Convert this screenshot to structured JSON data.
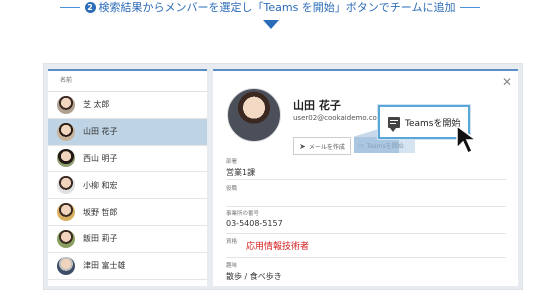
{
  "header": {
    "step_number": "2",
    "title": "検索結果からメンバーを選定し「Teams を開始」ボタンでチームに追加"
  },
  "list": {
    "column_header": "名前",
    "items": [
      {
        "name": "芝 太郎"
      },
      {
        "name": "山田 花子"
      },
      {
        "name": "西山 明子"
      },
      {
        "name": "小柳 和宏"
      },
      {
        "name": "坂野 哲郎"
      },
      {
        "name": "飯田 莉子"
      },
      {
        "name": "津田 富士雄"
      }
    ],
    "selected_index": 1
  },
  "detail": {
    "name": "山田 花子",
    "email": "user02@cookaidemo.co...",
    "mail_button": "メールを作成",
    "teams_button_ghost": "Teamsを開始",
    "teams_callout": "Teamsを開始",
    "fields": [
      {
        "label": "部署",
        "value": "営業1課"
      },
      {
        "label": "役職",
        "value": ""
      },
      {
        "label": "事業所の番号",
        "value": "03-5408-5157"
      },
      {
        "label": "資格",
        "value": "応用情報技術者"
      },
      {
        "label": "趣味",
        "value": "散歩 / 食べ歩き"
      }
    ]
  },
  "colors": {
    "accent": "#2b6cb8",
    "selected_row": "#bed3e3",
    "callout_border": "#5aa6d8",
    "highlight_text": "#d62020"
  }
}
